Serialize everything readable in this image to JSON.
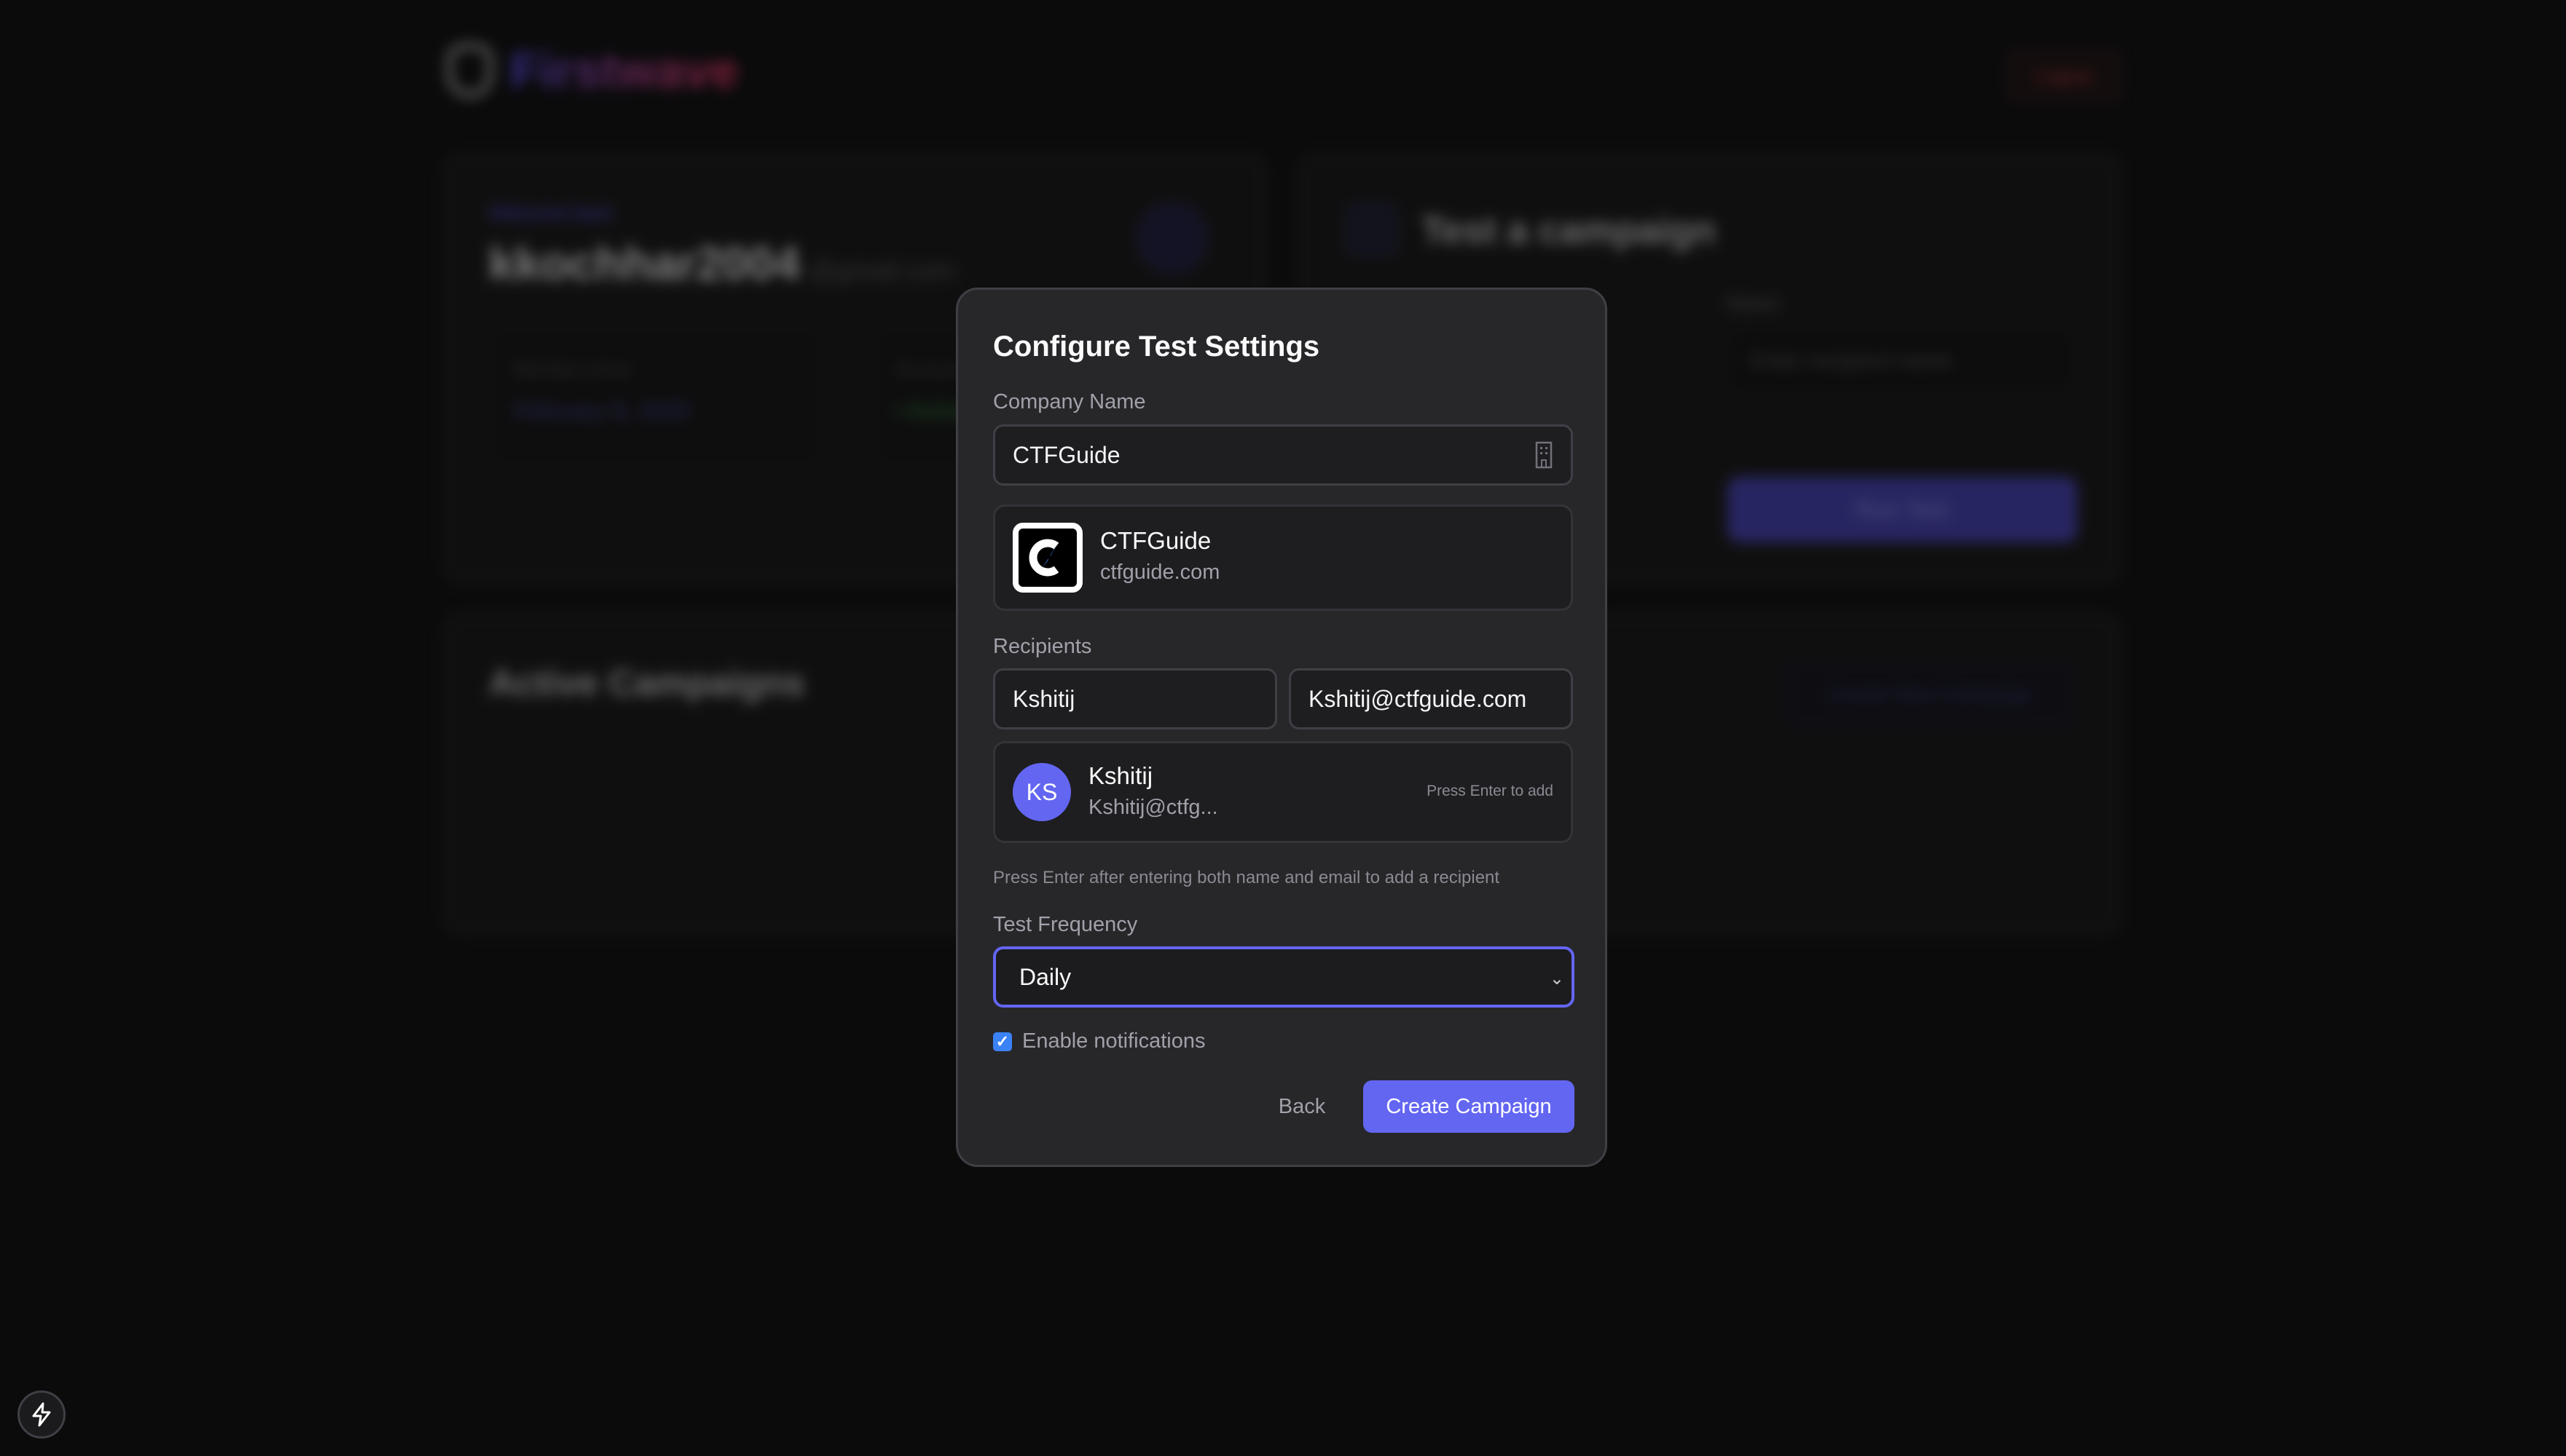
{
  "background": {
    "brand": {
      "name": "Firstwave",
      "logo_icon": "shield-check-icon"
    },
    "logout_label": "Logout",
    "profile_card": {
      "welcome": "Welcome back",
      "username": "kkochhar2004",
      "domain": "@gmail.com",
      "avatar_icon": "user-icon",
      "stats": [
        {
          "label": "Member since",
          "value": "February 8, 2025"
        },
        {
          "label": "Account status",
          "value": "• Active"
        }
      ]
    },
    "test_card": {
      "icon": "arrow-left-icon",
      "title": "Test a campaign",
      "name_label": "Name",
      "name_placeholder": "Enter recipient name",
      "run_label": "Run Test"
    },
    "campaigns_card": {
      "title": "Active Campaigns",
      "create_label": "Create New Campaign"
    }
  },
  "modal": {
    "title": "Configure Test Settings",
    "company_label": "Company Name",
    "company_value": "CTFGuide",
    "company_icon": "building-icon",
    "company_match": {
      "name": "CTFGuide",
      "domain": "ctfguide.com"
    },
    "recipients_label": "Recipients",
    "recipient_name_value": "Kshitij",
    "recipient_email_value": "Kshitij@ctfguide.com",
    "recipient_preview": {
      "initials": "KS",
      "name": "Kshitij",
      "email": "Kshitij@ctfg...",
      "hint": "Press Enter to add"
    },
    "help_text": "Press Enter after entering both name and email to add a recipient",
    "frequency_label": "Test Frequency",
    "frequency_value": "Daily",
    "notifications_label": "Enable notifications",
    "notifications_checked": true,
    "back_label": "Back",
    "create_label": "Create Campaign",
    "accent_color": "#6366f1"
  },
  "dev_badge_icon": "lightning-icon"
}
